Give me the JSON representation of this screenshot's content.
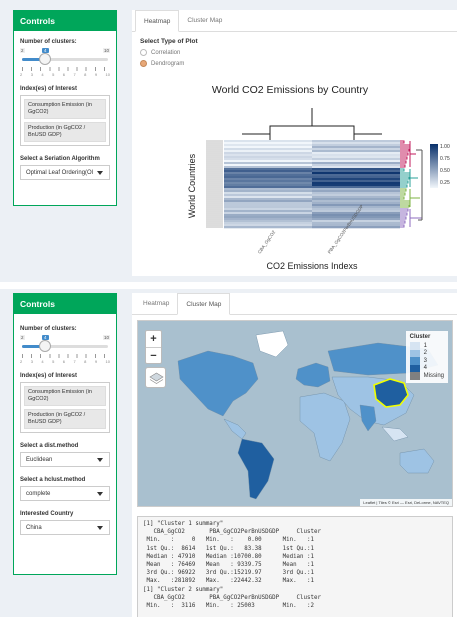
{
  "colors": {
    "green": "#00a65a",
    "slider_blue": "#428bca"
  },
  "top": {
    "sidebar": {
      "title": "Controls",
      "clusters_label": "Number of clusters:",
      "slider": {
        "min": "2",
        "max": "10",
        "value": "4",
        "ticks": [
          "2",
          "3",
          "4",
          "5",
          "6",
          "7",
          "8",
          "9",
          "10"
        ]
      },
      "index_label": "Index(es) of Interest",
      "index_chips": [
        "Consumption Emission (in GgCO2)",
        "Production (in GgCO2 / BnUSD GDP)"
      ],
      "seriation_label": "Select a Seriation Algorithm",
      "seriation_value": "Optimal Leaf Ordering(Ol"
    },
    "tabs": [
      {
        "label": "Heatmap"
      },
      {
        "label": "Cluster Map"
      }
    ],
    "plot_type_label": "Select Type of Plot",
    "plot_types": [
      {
        "label": "Correlation"
      },
      {
        "label": "Dendrogram"
      }
    ],
    "heatmap": {
      "title": "World CO2 Emissions by Country",
      "ylabel": "World Countries",
      "xlabel": "CO2 Emissions Indexs",
      "col_labels": [
        "CBA_GgCO2",
        "PBA_GgCO2PerBnUSDGDP"
      ],
      "scale_ticks": [
        "1.00",
        "0.75",
        "0.50",
        "0.25"
      ]
    }
  },
  "bottom": {
    "sidebar": {
      "title": "Controls",
      "clusters_label": "Number of clusters:",
      "slider": {
        "min": "2",
        "max": "10",
        "value": "4",
        "ticks": [
          "2",
          "3",
          "4",
          "5",
          "6",
          "7",
          "8",
          "9",
          "10"
        ]
      },
      "index_label": "Index(es) of Interest",
      "index_chips": [
        "Consumption Emission (in GgCO2)",
        "Production (in GgCO2 / BnUSD GDP)"
      ],
      "dist_label": "Select a dist.method",
      "dist_value": "Euclidean",
      "hclust_label": "Select a hclust.method",
      "hclust_value": "complete",
      "country_label": "Interested Country",
      "country_value": "China"
    },
    "tabs": [
      {
        "label": "Heatmap"
      },
      {
        "label": "Cluster Map"
      }
    ],
    "map": {
      "zoom_in": "+",
      "zoom_out": "−",
      "legend_title": "Cluster",
      "legend_items": [
        {
          "label": "1",
          "color": "#d6e4f2"
        },
        {
          "label": "2",
          "color": "#9ec3e4"
        },
        {
          "label": "3",
          "color": "#4f91c9"
        },
        {
          "label": "4",
          "color": "#1f5fa0"
        },
        {
          "label": "Missing",
          "color": "#808080"
        }
      ],
      "attribution": "Leaflet | Tiles © Esri — Esri, DeLorme, NAVTEQ"
    },
    "console_lines": [
      "[1] \"Cluster 1 summary\"",
      "   CBA_GgCO2       PBA_GgCO2PerBnUSDGDP     Cluster",
      " Min.   :     0   Min.   :    0.00      Min.   :1",
      " 1st Qu.:  8614   1st Qu.:   83.38      1st Qu.:1",
      " Median : 47910   Median :10700.80      Median :1",
      " Mean   : 76469   Mean   : 9339.75      Mean   :1",
      " 3rd Qu.: 96922   3rd Qu.:15219.97      3rd Qu.:1",
      " Max.   :281892   Max.   :22442.32      Max.   :1",
      "[1] \"Cluster 2 summary\"",
      "   CBA_GgCO2       PBA_GgCO2PerBnUSDGDP     Cluster",
      " Min.   :  3116   Min.   : 25003        Min.   :2"
    ]
  }
}
